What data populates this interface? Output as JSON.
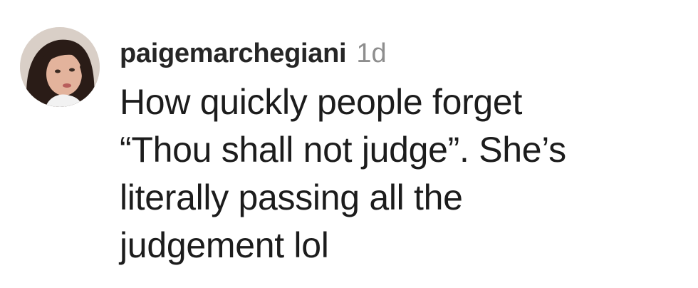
{
  "comment": {
    "username": "paigemarchegiani",
    "timestamp": "1d",
    "avatar_icon": "profile-photo",
    "text_lines": [
      "How quickly people forget",
      "“Thou shall not judge”. She’s",
      "literally passing all the",
      "judgement lol"
    ]
  },
  "colors": {
    "username": "#262626",
    "timestamp": "#8e8e8e",
    "text": "#1c1c1c",
    "background": "#ffffff"
  }
}
